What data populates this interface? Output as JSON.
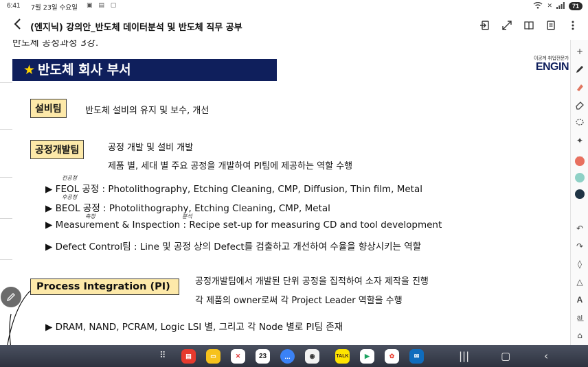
{
  "status": {
    "time": "6:41",
    "date": "7월 23일 수요일",
    "battery": "71"
  },
  "toolbar": {
    "title": "(엔지닉) 강의안_반도체 데이터분석 및 반도체 직무 공부"
  },
  "slide": {
    "handwriting_top": "반도체 공정과정 3강.",
    "banner": "반도체 회사 부서",
    "logo_small": "이공계 취업전문가",
    "logo_big": "ENGIN",
    "sections": {
      "equipment": {
        "tag": "설비팀",
        "desc": "반도체 설비의 유지 및 보수, 개선"
      },
      "process_dev": {
        "tag": "공정개발팀",
        "desc1": "공정 개발 및 설비 개발",
        "desc2": "제품 별, 세대 별 주요 공정을 개발하여 PI팀에 제공하는 역할 수행",
        "bullets": [
          "▶ FEOL 공정 : Photolithography, Etching Cleaning, CMP, Diffusion, Thin film, Metal",
          "▶ BEOL 공정 : Photolithography, Etching Cleaning, CMP, Metal",
          "▶ Measurement & Inspection : Recipe set-up for measuring CD and tool development",
          "▶ Defect Control팀 : Line 및 공정 상의 Defect를 검출하고 개선하여 수율을 향상시키는 역할"
        ],
        "annotations": [
          "전공정",
          "후공정",
          "측정",
          "분석"
        ]
      },
      "pi": {
        "tag": "Process Integration (PI)",
        "desc1": "공정개발팀에서 개발된 단위 공정을 집적하여 소자 제작을 진행",
        "desc2": "각 제품의 owner로써 각 Project Leader 역할을 수행",
        "bullet": "▶ DRAM, NAND, PCRAM, Logic LSI 별, 그리고 각 Node 별로 PI팀 존재"
      }
    }
  },
  "palette": {
    "colors": [
      "#e8705f",
      "#8fd1c6",
      "#1f3444"
    ]
  },
  "taskbar": {
    "calendar_day": "23",
    "talk_label": "TALK"
  },
  "icons": {
    "back": "chevron-left-icon",
    "pen_fab": "pen-icon"
  }
}
